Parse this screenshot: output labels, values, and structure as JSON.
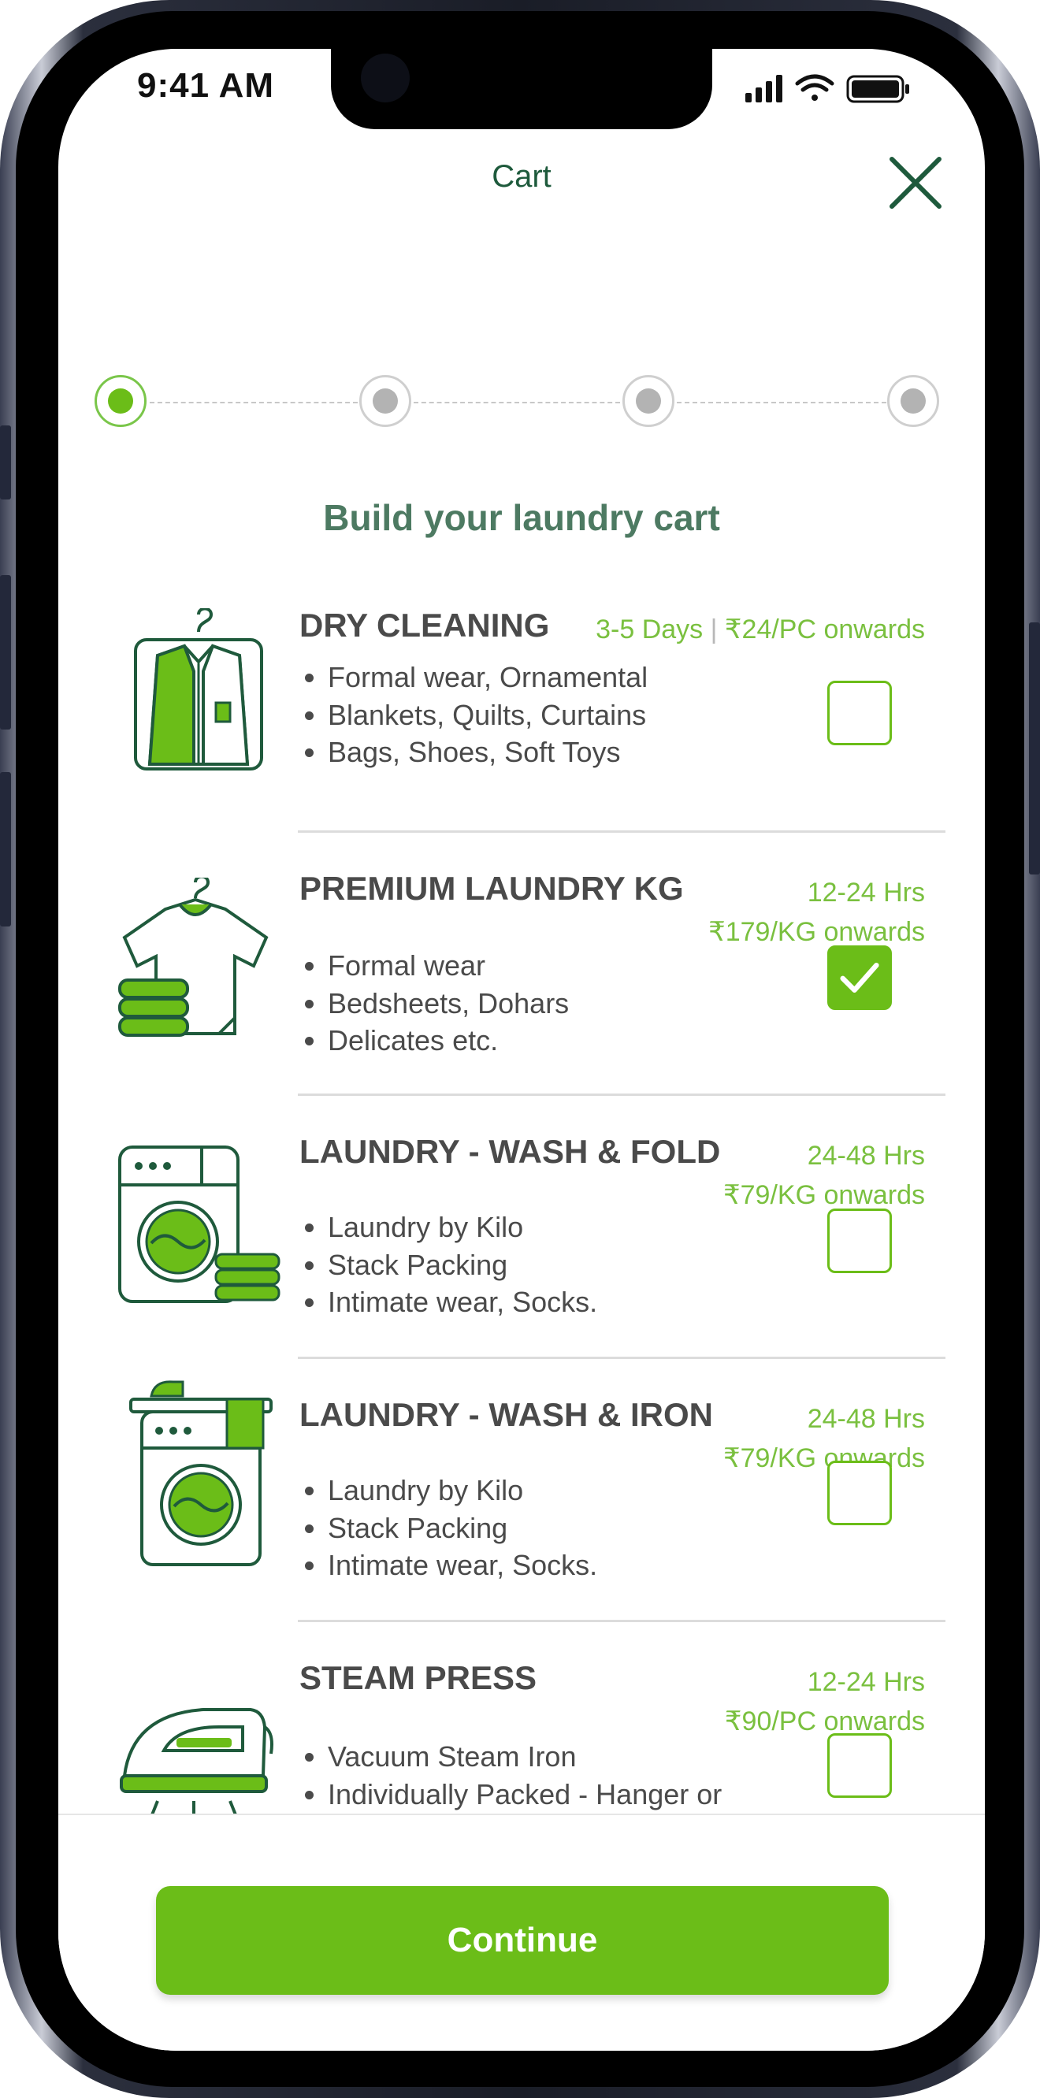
{
  "status_bar": {
    "time": "9:41 AM"
  },
  "header": {
    "title": "Cart",
    "close_icon": "close-icon"
  },
  "stepper": {
    "steps": 4,
    "current": 1
  },
  "section_title": "Build your laundry cart",
  "services": [
    {
      "name": "DRY CLEANING",
      "meta_line1": "3-5 Days",
      "meta_line2": "₹24/PC onwards",
      "features": [
        "Formal wear, Ornamental",
        "Blankets, Quilts, Curtains",
        "Bags, Shoes, Soft Toys"
      ],
      "checked": false
    },
    {
      "name": "PREMIUM LAUNDRY KG",
      "meta_line1": "12-24 Hrs",
      "meta_line2": "₹179/KG onwards",
      "features": [
        "Formal wear",
        "Bedsheets, Dohars",
        "Delicates etc."
      ],
      "checked": true
    },
    {
      "name": "LAUNDRY - WASH & FOLD",
      "meta_line1": "24-48 Hrs",
      "meta_line2": "₹79/KG onwards",
      "features": [
        "Laundry by Kilo",
        "Stack Packing",
        "Intimate wear, Socks."
      ],
      "checked": false
    },
    {
      "name": "LAUNDRY - WASH & IRON",
      "meta_line1": "24-48 Hrs",
      "meta_line2": "₹79/KG onwards",
      "features": [
        "Laundry by Kilo",
        "Stack Packing",
        "Intimate wear, Socks."
      ],
      "checked": false
    },
    {
      "name": "STEAM PRESS",
      "meta_line1": "12-24 Hrs",
      "meta_line2": "₹90/PC onwards",
      "features": [
        "Vacuum Steam Iron",
        "Individually Packed - Hanger or Folded"
      ],
      "checked": false
    }
  ],
  "continue_label": "Continue",
  "colors": {
    "accent": "#6bbd18",
    "dark_green": "#1e5a3c",
    "heading_green": "#4d7a62",
    "meta_green": "#7ac03f"
  }
}
